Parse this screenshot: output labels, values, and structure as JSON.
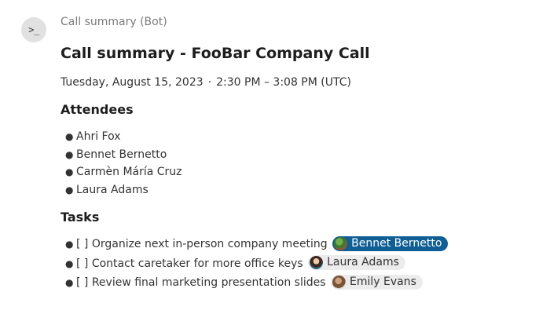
{
  "bot": {
    "avatar_glyph": ">_",
    "sender": "Call summary (Bot)"
  },
  "summary": {
    "title": "Call summary - FooBar Company Call",
    "date": "Tuesday, August 15, 2023",
    "separator": "·",
    "time_range": "2:30 PM – 3:08 PM (UTC)"
  },
  "attendees": {
    "heading": "Attendees",
    "items": [
      "Ahri Fox",
      "Bennet Bernetto",
      "Carmèn Máría Cruz",
      "Laura Adams"
    ]
  },
  "tasks": {
    "heading": "Tasks",
    "items": [
      {
        "text": "[ ] Organize next in-person company meeting",
        "assignee": "Bennet Bernetto",
        "selected": true
      },
      {
        "text": "[ ] Contact caretaker for more office keys",
        "assignee": "Laura Adams",
        "selected": false
      },
      {
        "text": "[ ] Review final marketing presentation slides",
        "assignee": "Emily Evans",
        "selected": false
      }
    ]
  },
  "colors": {
    "chip_selected_bg": "#0f5e96",
    "chip_bg": "#ececec",
    "avatar_bg": "#e1e1e1"
  },
  "icons": {
    "bot_avatar": "terminal-icon",
    "bullet": "bullet-dot"
  }
}
